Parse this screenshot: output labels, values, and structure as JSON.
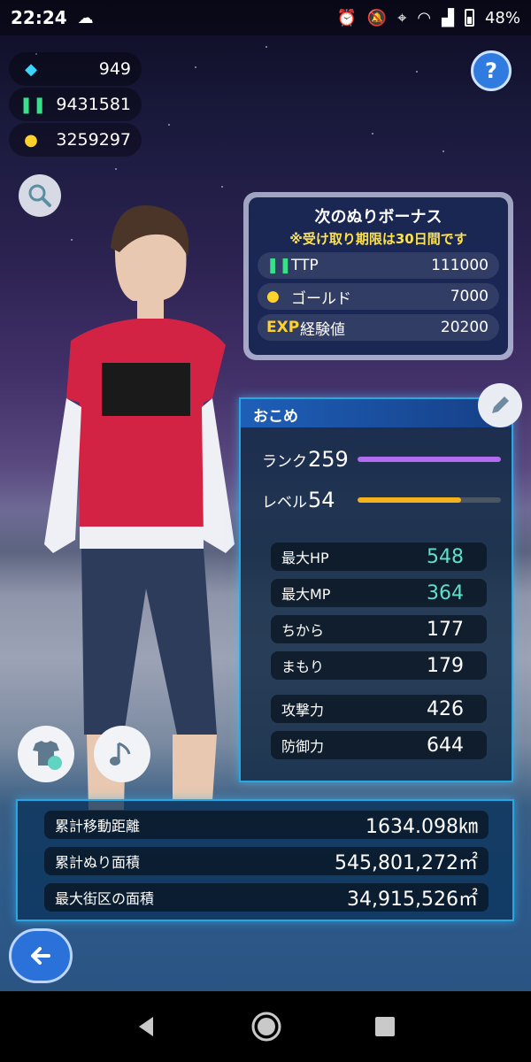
{
  "status_bar": {
    "time": "22:24",
    "battery": "48%"
  },
  "currencies": {
    "gems": "949",
    "ttp": "9431581",
    "gold": "3259297"
  },
  "bonus": {
    "title": "次のぬりボーナス",
    "note": "※受け取り期限は30日間です",
    "rows": [
      {
        "icon": "footprints-icon",
        "label": "TTP",
        "value": "111000"
      },
      {
        "icon": "gold-coin-icon",
        "label": "ゴールド",
        "value": "7000"
      },
      {
        "icon": "EXP",
        "label": "経験値",
        "value": "20200"
      }
    ]
  },
  "stats": {
    "player_name": "おこめ",
    "rank_label": "ランク",
    "rank_value": "259",
    "level_label": "レベル",
    "level_value": "54",
    "items": [
      {
        "label": "最大HP",
        "value": "548",
        "color": "#5fe0c8"
      },
      {
        "label": "最大MP",
        "value": "364",
        "color": "#5fe0c8"
      },
      {
        "label": "ちから",
        "value": "177",
        "color": "#ffffff"
      },
      {
        "label": "まもり",
        "value": "179",
        "color": "#ffffff"
      },
      {
        "label": "攻撃力",
        "value": "426",
        "color": "#ffffff"
      },
      {
        "label": "防御力",
        "value": "644",
        "color": "#ffffff"
      }
    ]
  },
  "totals": [
    {
      "label": "累計移動距離",
      "value": "1634.098㎞"
    },
    {
      "label": "累計ぬり面積",
      "value": "545,801,272㎡"
    },
    {
      "label": "最大街区の面積",
      "value": "34,915,526㎡"
    }
  ],
  "colors": {
    "accent": "#2aa6e0",
    "rank_bar": "#b36cf0",
    "level_bar": "#f5b21d",
    "bonus_note": "#ffe24a"
  }
}
